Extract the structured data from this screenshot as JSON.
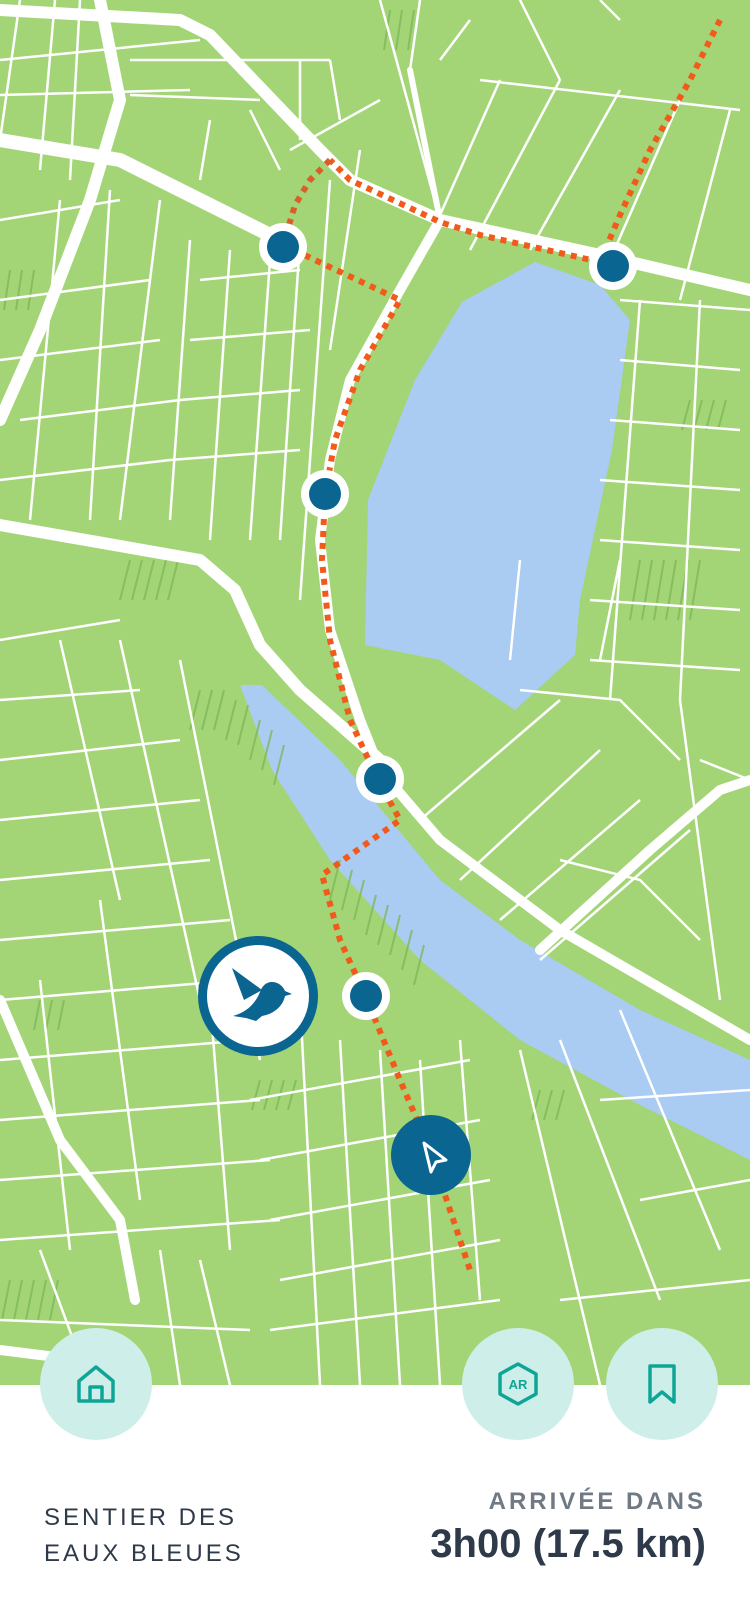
{
  "map": {
    "land_color": "#a3d576",
    "water_color": "#aacbf2",
    "road_color": "#ffffff",
    "route_color": "#f25a1c",
    "marker_color": "#0a6591",
    "markers_icon": "dot-marker",
    "bird_marker_icon": "bird-icon",
    "position_marker_icon": "navigation-arrow-icon"
  },
  "buttons": {
    "home": {
      "icon": "home-icon"
    },
    "ar": {
      "icon": "ar-cube-icon",
      "label": "AR"
    },
    "bookmark": {
      "icon": "bookmark-icon"
    }
  },
  "trail": {
    "name_line1": "SENTIER DES",
    "name_line2": "EAUX BLEUES"
  },
  "eta": {
    "label": "ARRIVÉE DANS",
    "value": "3h00 (17.5 km)"
  },
  "colors": {
    "accent": "#0fa596",
    "fab_background": "#cdeee9",
    "text_dark": "#2e3a4a",
    "text_muted": "#6f7a85"
  }
}
